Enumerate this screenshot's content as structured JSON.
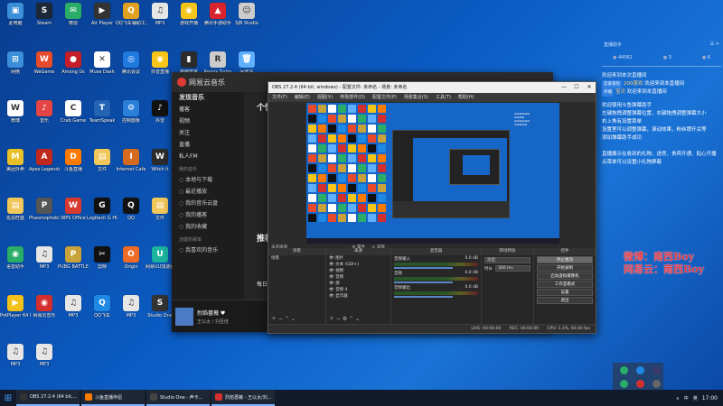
{
  "desktop": {
    "icons": [
      {
        "label": "此电脑",
        "color": "#3b8fd9",
        "glyph": "▣"
      },
      {
        "label": "Steam",
        "color": "#1b2838",
        "glyph": "S"
      },
      {
        "label": "微信",
        "color": "#2aae67",
        "glyph": "✉"
      },
      {
        "label": "Air Player",
        "color": "#333",
        "glyph": "▶"
      },
      {
        "label": "QQ飞车辅助工具",
        "color": "#e0a020",
        "glyph": "Q"
      },
      {
        "label": "MP3",
        "color": "#e6e6e6",
        "glyph": "♫"
      },
      {
        "label": "游戏开播",
        "color": "#f5c518",
        "glyph": "◉"
      },
      {
        "label": "腾讯手游助手",
        "color": "#d9232d",
        "glyph": "▲"
      },
      {
        "label": "SJB Studio",
        "color": "#ccc",
        "glyph": "☺"
      },
      {
        "label": "网络",
        "color": "#3b8fd9",
        "glyph": "⊞"
      },
      {
        "label": "WeGame",
        "color": "#e84a2b",
        "glyph": "W"
      },
      {
        "label": "Among Us",
        "color": "#c41e2b",
        "glyph": "●"
      },
      {
        "label": "Muse Dash",
        "color": "#fff",
        "glyph": "✕"
      },
      {
        "label": "腾讯会议",
        "color": "#1f7ae0",
        "glyph": "◎"
      },
      {
        "label": "抖音直播",
        "color": "#f5c518",
        "glyph": "◉"
      },
      {
        "label": "电脑管家",
        "color": "#2c2c2c",
        "glyph": "▮"
      },
      {
        "label": "Remix Turbo",
        "color": "#ccc",
        "glyph": "R"
      },
      {
        "label": "回收站",
        "color": "#5fb0ff",
        "glyph": "🗑"
      },
      {
        "label": "微博",
        "color": "#ffffff",
        "glyph": "W"
      },
      {
        "label": "音乐",
        "color": "#e64545",
        "glyph": "♪"
      },
      {
        "label": "Crab Game",
        "color": "#fff",
        "glyph": "C"
      },
      {
        "label": "TeamSpeak",
        "color": "#2364b5",
        "glyph": "T"
      },
      {
        "label": "控制面板",
        "color": "#2a7fd9",
        "glyph": "⚙"
      },
      {
        "label": "抖音",
        "color": "#111",
        "glyph": "♪"
      },
      {
        "label": "MP3",
        "color": "#e6e6e6",
        "glyph": "♫"
      },
      {
        "label": "Dread Hunger",
        "color": "#333",
        "glyph": "✦"
      },
      {
        "label": "谷歌浏览器",
        "color": "#eee",
        "glyph": "◉"
      },
      {
        "label": "美团外卖",
        "color": "#e8c12a",
        "glyph": "M"
      },
      {
        "label": "Apex Legends",
        "color": "#c1281d",
        "glyph": "A"
      },
      {
        "label": "斗鱼直播",
        "color": "#ff7a00",
        "glyph": "D"
      },
      {
        "label": "文件",
        "color": "#f1c75b",
        "glyph": "▤"
      },
      {
        "label": "Internet Cafe",
        "color": "#d46b1f",
        "glyph": "I"
      },
      {
        "label": "Witch It",
        "color": "#2b2b2b",
        "glyph": "W"
      },
      {
        "label": "游戏",
        "color": "#1e1e1e",
        "glyph": "A"
      },
      {
        "label": "Epic Games Launcher",
        "color": "#111",
        "glyph": "E"
      },
      {
        "label": "斗鱼直播伴侣",
        "color": "#ff7a00",
        "glyph": "D"
      },
      {
        "label": "佐思旺盛",
        "color": "#f1c75b",
        "glyph": "▤"
      },
      {
        "label": "Phasmophobia",
        "color": "#555",
        "glyph": "P"
      },
      {
        "label": "WPS Office",
        "color": "#d93a2f",
        "glyph": "W"
      },
      {
        "label": "Logitech G HUB",
        "color": "#111",
        "glyph": "G"
      },
      {
        "label": "QQ",
        "color": "#111",
        "glyph": "Q"
      },
      {
        "label": "文件",
        "color": "#f1c75b",
        "glyph": "▤"
      },
      {
        "label": "PLAYERUNKNOWN",
        "color": "#c9a23a",
        "glyph": "P"
      },
      {
        "label": "YY开播",
        "color": "#f5c518",
        "glyph": "Y"
      },
      {
        "label": "OBS Studio",
        "color": "#222",
        "glyph": "◐"
      },
      {
        "label": "语音助手",
        "color": "#2aae67",
        "glyph": "◉"
      },
      {
        "label": "MP3",
        "color": "#e6e6e6",
        "glyph": "♫"
      },
      {
        "label": "PUBG BATTLEGROUNDS",
        "color": "#c9a23a",
        "glyph": "P"
      },
      {
        "label": "剪映",
        "color": "#111",
        "glyph": "✂"
      },
      {
        "label": "Origin",
        "color": "#f06c26",
        "glyph": "O"
      },
      {
        "label": "网易UU加速器",
        "color": "#1bb3a0",
        "glyph": "U"
      },
      {
        "label": "网易云音乐",
        "color": "#d32f2f",
        "glyph": "◉"
      },
      {
        "label": "Funmet Party",
        "color": "#ff8a1f",
        "glyph": "F"
      },
      {
        "label": "爱奇艺",
        "color": "#2aae67",
        "glyph": "i"
      },
      {
        "label": "PotPlayer 64 bit",
        "color": "#f2c21b",
        "glyph": "▶"
      },
      {
        "label": "网易云音乐",
        "color": "#d32f2f",
        "glyph": "◉"
      },
      {
        "label": "MP3",
        "color": "#e6e6e6",
        "glyph": "♫"
      },
      {
        "label": "QQ飞车",
        "color": "#1e88e5",
        "glyph": "Q"
      },
      {
        "label": "MP3",
        "color": "#e6e6e6",
        "glyph": "♫"
      },
      {
        "label": "Studio One",
        "color": "#333",
        "glyph": "S"
      },
      {
        "label": "Les Moujan",
        "color": "#444",
        "glyph": "L"
      },
      {
        "label": "辅助 · 神裁",
        "color": "#5b3fa3",
        "glyph": "✦"
      },
      {
        "label": "PICO PARK",
        "color": "#eee",
        "glyph": "P"
      },
      {
        "label": "MP3",
        "color": "#e6e6e6",
        "glyph": "♫"
      },
      {
        "label": "MP3",
        "color": "#e6e6e6",
        "glyph": "♫"
      }
    ]
  },
  "music": {
    "brand": "网易云音乐",
    "side_items": [
      {
        "label": "发现音乐",
        "style": "big"
      },
      {
        "label": "播客",
        "style": ""
      },
      {
        "label": "视频",
        "style": ""
      },
      {
        "label": "关注",
        "style": ""
      },
      {
        "label": "直播",
        "style": ""
      },
      {
        "label": "私人FM",
        "style": ""
      }
    ],
    "my_music_section": "我的音乐",
    "my_items": [
      "本地与下载",
      "最近播放",
      "我的音乐云盘",
      "我的播客",
      "我的收藏"
    ],
    "created_section": "创建的歌单",
    "liked": "我喜欢的音乐",
    "heading": "个性",
    "recommend": "推荐",
    "daily": "每日",
    "player": {
      "song": "烈焰蔷薇 ♥",
      "artist": "王以太 / 刘至佳"
    }
  },
  "obs": {
    "title": "OBS 27.2.4 (64-bit, windows) - 配置文件: 未命名 - 场景: 未命名",
    "menu": [
      "文件(F)",
      "编辑(E)",
      "视图(V)",
      "停靠部件(D)",
      "配置文件(P)",
      "场景集合(S)",
      "工具(T)",
      "帮助(H)"
    ],
    "no_source": "未选择源",
    "properties_label": "属性",
    "filters_label": "滤镜",
    "docks": {
      "scenes": {
        "title": "场景",
        "items": [
          "场景"
        ]
      },
      "sources": {
        "title": "来源",
        "items": [
          "图片",
          "文本 (GDI+)",
          "视频",
          "音频",
          "源",
          "音频 4",
          "显示器"
        ]
      },
      "mixer": {
        "title": "混音器",
        "channels": [
          {
            "name": "音频输入",
            "db": "0.0 dB"
          },
          {
            "name": "音频",
            "db": "0.0 dB"
          },
          {
            "name": "音频输出",
            "db": "0.0 dB"
          }
        ]
      },
      "transitions": {
        "title": "转场特效",
        "type": "淡出",
        "duration_label": "时长",
        "duration": "300 ms"
      },
      "controls": {
        "title": "控件",
        "buttons": [
          "停止推流",
          "开始录制",
          "启动虚拟摄像机",
          "工作室模式",
          "设置",
          "退出"
        ]
      }
    },
    "status": {
      "live": "LIVE: 00:00:00",
      "rec": "REC: 00:00:00",
      "cpu": "CPU: 1.3%, 60.00 fps"
    }
  },
  "chat": {
    "header_left": "直播助手",
    "header_right": "☰ ✕",
    "stats": [
      "44561",
      "3",
      "6"
    ],
    "messages": [
      {
        "badge": "",
        "user": "",
        "text": "欢迎来到本次直播间"
      },
      {
        "badge": "恋爱冒险",
        "user": "200喜欢",
        "text": "欢迎来到本直播间"
      },
      {
        "badge": "开播",
        "user": "宝贝",
        "text": "欢迎来到本直播间"
      }
    ],
    "notice_lines": [
      "欢迎使用斗鱼弹幕助手",
      "左键拖拽调整弹幕位置，右键拖拽调整弹幕大小",
      "右上角有设置菜单",
      "设置里可以调整弹幕，滚动效果，粉丝牌开关等",
      "添加弹幕助手成功",
      "",
      "直播展示在收到的礼物、进房、贵宾开通、贴心开播",
      "点菜单可以设置小礼物屏蔽"
    ]
  },
  "weibo_overlay": {
    "line1": "微博：南西Boy",
    "line2": "网易云：南西Boy"
  },
  "taskbar": {
    "items": [
      {
        "label": "OBS 27.2.4 (64 bit,...",
        "color": "#333"
      },
      {
        "label": "斗鱼直播伴侣",
        "color": "#ff7a00"
      },
      {
        "label": "Studio One - 声卡...",
        "color": "#444"
      },
      {
        "label": "烈焰蔷薇 - 王以太/刘...",
        "color": "#d32f2f"
      }
    ],
    "tray": [
      "∧",
      "中",
      "英"
    ],
    "clock": "17:00"
  }
}
